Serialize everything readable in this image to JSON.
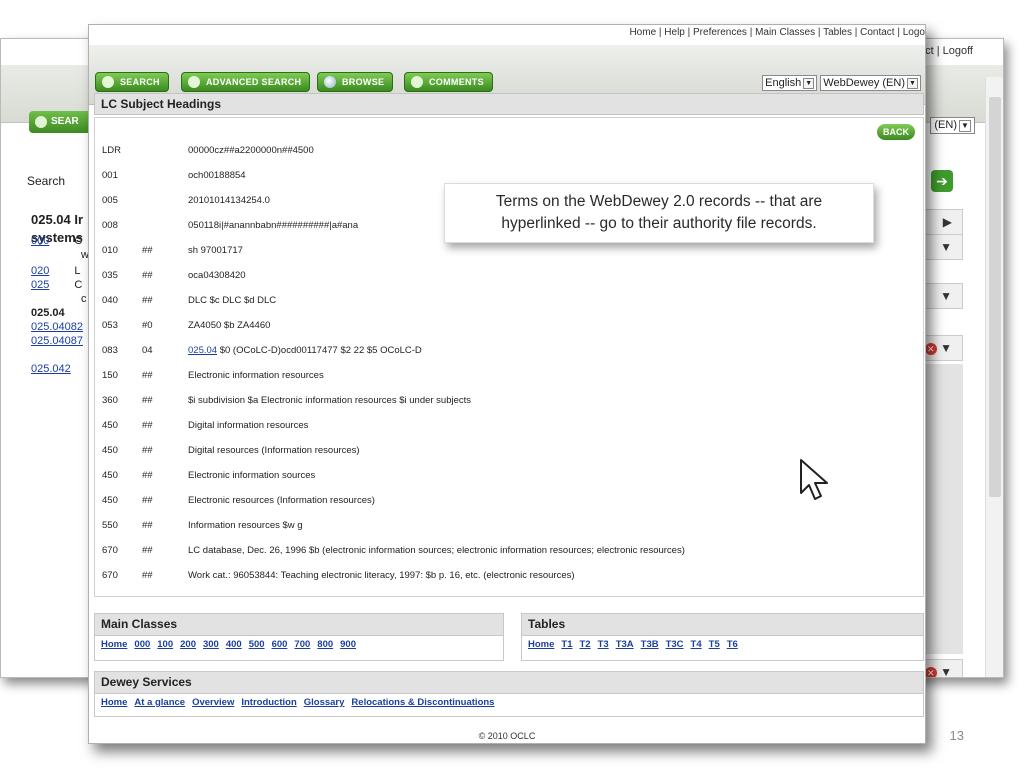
{
  "back_window": {
    "top_nav": "ct | Logoff",
    "search_button": "SEAR",
    "lang_select": "(EN)",
    "search_label": "Search",
    "heading_line1": "025.04 Ir",
    "heading_line2": "systems",
    "number_fragment": "6",
    "side_items": [
      {
        "code": "000",
        "text": "C"
      },
      {
        "code": "",
        "text": "w"
      },
      {
        "code": "020",
        "text": "L"
      },
      {
        "code": "025",
        "text": "C"
      },
      {
        "code": "",
        "text": "c"
      },
      {
        "code": "025.04",
        "text": ""
      },
      {
        "code": "025.04082",
        "text": ""
      },
      {
        "code": "025.04087",
        "text": ""
      },
      {
        "code": "025.042",
        "text": ""
      }
    ]
  },
  "front_window": {
    "top_nav": "Home | Help | Preferences | Main Classes | Tables | Contact | Logo",
    "toolbar": {
      "search": "SEARCH",
      "advanced_search": "ADVANCED SEARCH",
      "browse": "BROWSE",
      "comments": "COMMENTS"
    },
    "language": "English",
    "edition": "WebDewey (EN)",
    "section_title": "LC Subject Headings",
    "back_button": "BACK",
    "records": [
      {
        "tag": "LDR",
        "ind": "",
        "value": "00000cz##a2200000n##4500"
      },
      {
        "tag": "001",
        "ind": "",
        "value": "och00188854"
      },
      {
        "tag": "005",
        "ind": "",
        "value": "20101014134254.0"
      },
      {
        "tag": "008",
        "ind": "",
        "value": "050118i|#anannbabn##########|a#ana"
      },
      {
        "tag": "010",
        "ind": "##",
        "value": "sh 97001717"
      },
      {
        "tag": "035",
        "ind": "##",
        "value": "oca04308420"
      },
      {
        "tag": "040",
        "ind": "##",
        "value": "DLC $c DLC $d DLC"
      },
      {
        "tag": "053",
        "ind": "#0",
        "value": "ZA4050 $b ZA4460"
      },
      {
        "tag": "083",
        "ind": "04",
        "link": "025.04",
        "value": " $0 (OCoLC-D)ocd00117477 $2 22 $5 OCoLC-D"
      },
      {
        "tag": "150",
        "ind": "##",
        "value": "Electronic information resources"
      },
      {
        "tag": "360",
        "ind": "##",
        "value": "$i subdivision $a Electronic information resources $i under subjects"
      },
      {
        "tag": "450",
        "ind": "##",
        "value": "Digital information resources"
      },
      {
        "tag": "450",
        "ind": "##",
        "value": "Digital resources (Information resources)"
      },
      {
        "tag": "450",
        "ind": "##",
        "value": "Electronic information sources"
      },
      {
        "tag": "450",
        "ind": "##",
        "value": "Electronic resources (Information resources)"
      },
      {
        "tag": "550",
        "ind": "##",
        "value": "Information resources $w g"
      },
      {
        "tag": "670",
        "ind": "##",
        "value": "LC database, Dec. 26, 1996 $b (electronic information sources; electronic information resources; electronic resources)"
      },
      {
        "tag": "670",
        "ind": "##",
        "value": "Work cat.: 96053844: Teaching electronic literacy, 1997: $b p. 16, etc. (electronic resources)"
      }
    ],
    "callout_line1": "Terms on the WebDewey 2.0 records -- that are",
    "callout_line2": "hyperlinked --  go to their authority file records.",
    "main_classes": {
      "title": "Main Classes",
      "links": [
        "Home",
        "000",
        "100",
        "200",
        "300",
        "400",
        "500",
        "600",
        "700",
        "800",
        "900"
      ]
    },
    "tables": {
      "title": "Tables",
      "links": [
        "Home",
        "T1",
        "T2",
        "T3",
        "T3A",
        "T3B",
        "T3C",
        "T4",
        "T5",
        "T6"
      ]
    },
    "dewey_services": {
      "title": "Dewey Services",
      "links": [
        "Home",
        "At a glance",
        "Overview",
        "Introduction",
        "Glossary",
        "Relocations & Discontinuations"
      ]
    },
    "copyright": "© 2010 OCLC"
  },
  "slide_number": "13",
  "icons": {
    "search": "search-icon",
    "globe": "globe-icon",
    "comment": "comment-icon",
    "cursor": "mouse-pointer-icon",
    "close": "close-icon",
    "dropdown": "chevron-down-icon"
  },
  "colors": {
    "button_green": "#3a8a1f",
    "link_blue": "#1a3fa0",
    "close_red": "#d63a2f"
  }
}
